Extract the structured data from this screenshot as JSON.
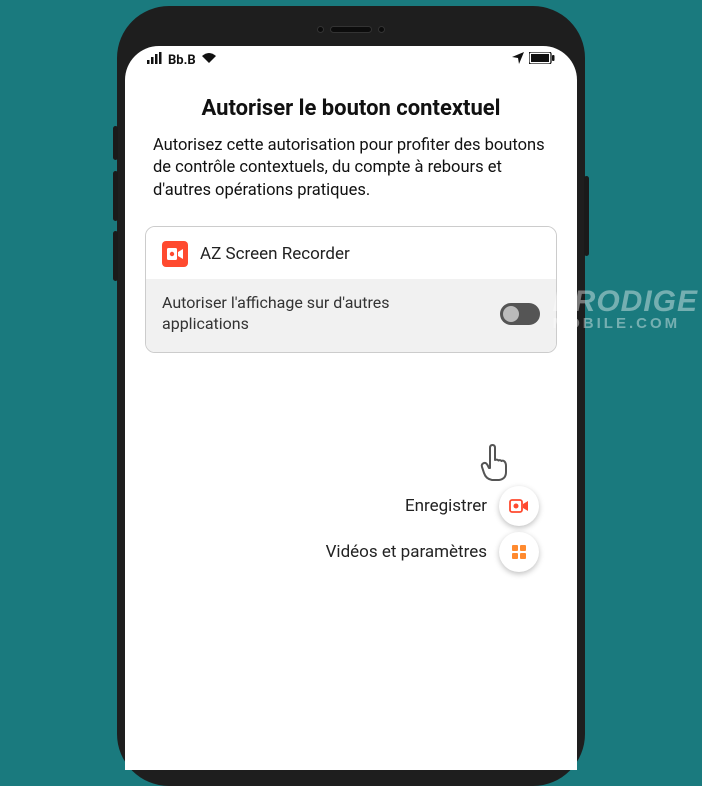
{
  "status": {
    "carrier": "Bb.B"
  },
  "dialog": {
    "title": "Autoriser le bouton contextuel",
    "description": "Autorisez cette autorisation pour profiter des boutons de contrôle contextuels, du compte à rebours et d'autres opérations pratiques."
  },
  "app": {
    "name": "AZ Screen Recorder"
  },
  "permission": {
    "label": "Autoriser l'affichage sur d'autres applications",
    "enabled": false
  },
  "floating": {
    "record_label": "Enregistrer",
    "settings_label": "Vidéos et paramètres"
  },
  "watermark": {
    "line1": "PRODIGE",
    "line2": "MOBILE.COM"
  },
  "colors": {
    "accent": "#ff4a2f",
    "background": "#1a7a7e"
  }
}
